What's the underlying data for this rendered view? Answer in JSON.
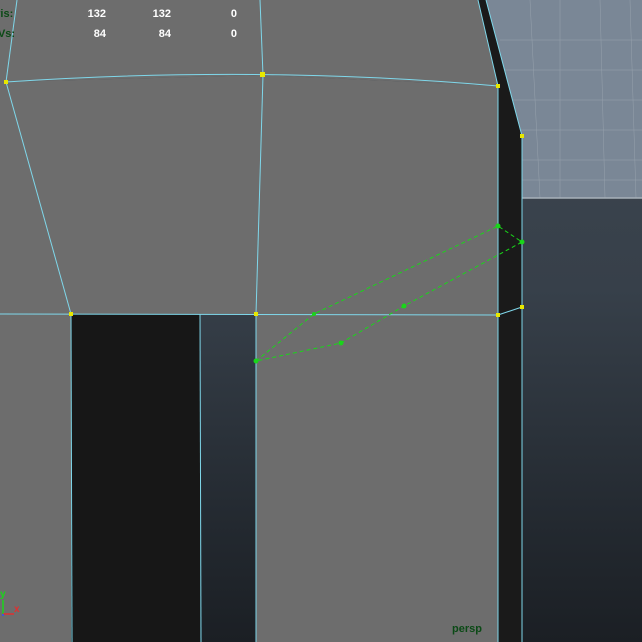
{
  "hud": {
    "tris": {
      "label": "Tris:",
      "values": [
        "132",
        "132",
        "0"
      ]
    },
    "uvs": {
      "label": "UVs:",
      "values": [
        "84",
        "84",
        "0"
      ]
    }
  },
  "camera": {
    "label": "persp"
  },
  "axis": {
    "x": "x",
    "y": "y"
  },
  "colors": {
    "mesh_face": "#6d6d6d",
    "wireframe": "#7fd7ea",
    "vertex": "#e8e800",
    "selection": "#19d619",
    "hud_label": "#0b4a16"
  }
}
